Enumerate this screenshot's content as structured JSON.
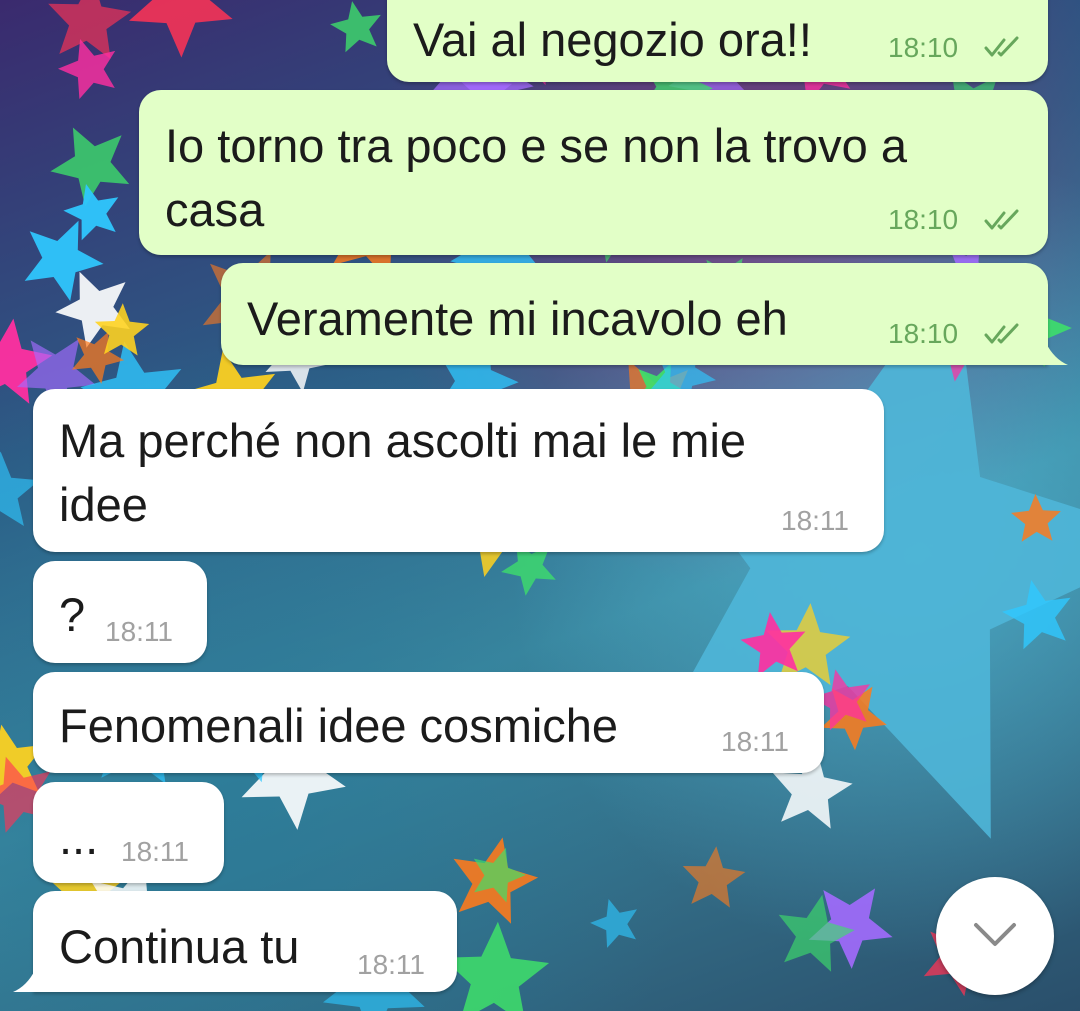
{
  "colors": {
    "outgoing_bubble": "#e2ffc7",
    "incoming_bubble": "#ffffff",
    "outgoing_time": "#67a75c",
    "incoming_time": "#a1a1a1",
    "read_ticks": "#67a75c"
  },
  "messages": [
    {
      "direction": "outgoing",
      "text": "Vai al negozio ora!!",
      "time": "18:10",
      "status": "read",
      "status_icon": "double-check-icon"
    },
    {
      "direction": "outgoing",
      "text_lines": [
        "Io torno tra poco e se non la trovo a",
        "casa"
      ],
      "time": "18:10",
      "status": "read",
      "status_icon": "double-check-icon"
    },
    {
      "direction": "outgoing",
      "text": "Veramente mi incavolo eh",
      "time": "18:10",
      "status": "read",
      "status_icon": "double-check-icon"
    },
    {
      "direction": "incoming",
      "text_lines": [
        "Ma perché non ascolti mai le mie",
        "idee"
      ],
      "time": "18:11"
    },
    {
      "direction": "incoming",
      "text": "?",
      "time": "18:11"
    },
    {
      "direction": "incoming",
      "text": "Fenomenali idee cosmiche",
      "time": "18:11"
    },
    {
      "direction": "incoming",
      "text": "...",
      "time": "18:11"
    },
    {
      "direction": "incoming",
      "text": "Continua tu",
      "time": "18:11"
    }
  ],
  "scroll_down_button": {
    "icon": "chevron-down-icon"
  },
  "wallpaper": {
    "description_icon": "confetti-stars-icon"
  }
}
